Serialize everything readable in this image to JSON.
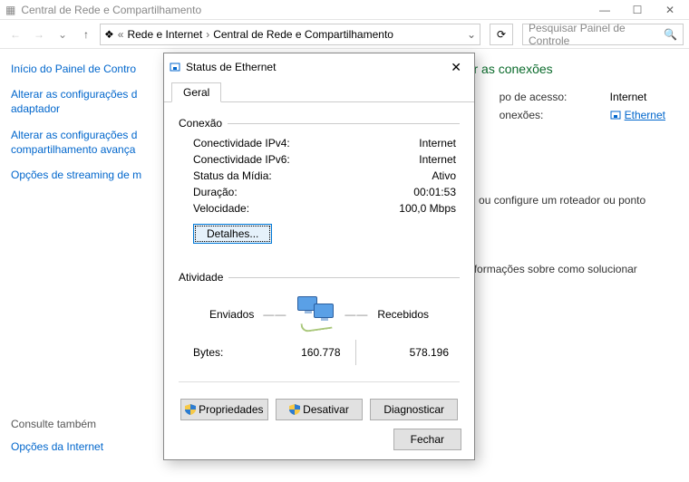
{
  "window": {
    "title": "Central de Rede e Compartilhamento",
    "breadcrumb": {
      "b1": "Rede e Internet",
      "b2": "Central de Rede e Compartilhamento"
    },
    "search_placeholder": "Pesquisar Painel de Controle"
  },
  "sidebar": {
    "home": "Início do Painel de Contro",
    "adapter": "Alterar as configurações d adaptador",
    "sharing": "Alterar as configurações d compartilhamento avança",
    "streaming": "Opções de streaming de m",
    "see_also": "Consulte também",
    "inet_opts": "Opções da Internet"
  },
  "main": {
    "heading": "Exibir suas informações básicas de rede e configurar as conexões",
    "access_type_label": "po de acesso:",
    "access_type_value": "Internet",
    "connections_label": "onexões:",
    "connections_value": "Ethernet",
    "hint1": "ou VPN; ou configure um roteador ou ponto",
    "hint2": "tenha informações sobre como solucionar"
  },
  "dialog": {
    "title": "Status de Ethernet",
    "tab_general": "Geral",
    "grp_connection": "Conexão",
    "rows": {
      "ipv4_l": "Conectividade IPv4:",
      "ipv4_v": "Internet",
      "ipv6_l": "Conectividade IPv6:",
      "ipv6_v": "Internet",
      "media_l": "Status da Mídia:",
      "media_v": "Ativo",
      "dur_l": "Duração:",
      "dur_v": "00:01:53",
      "spd_l": "Velocidade:",
      "spd_v": "100,0 Mbps"
    },
    "details_btn": "Detalhes...",
    "grp_activity": "Atividade",
    "sent_label": "Enviados",
    "recv_label": "Recebidos",
    "bytes_label": "Bytes:",
    "bytes_sent": "160.778",
    "bytes_recv": "578.196",
    "btn_props": "Propriedades",
    "btn_disable": "Desativar",
    "btn_diag": "Diagnosticar",
    "btn_close": "Fechar"
  }
}
